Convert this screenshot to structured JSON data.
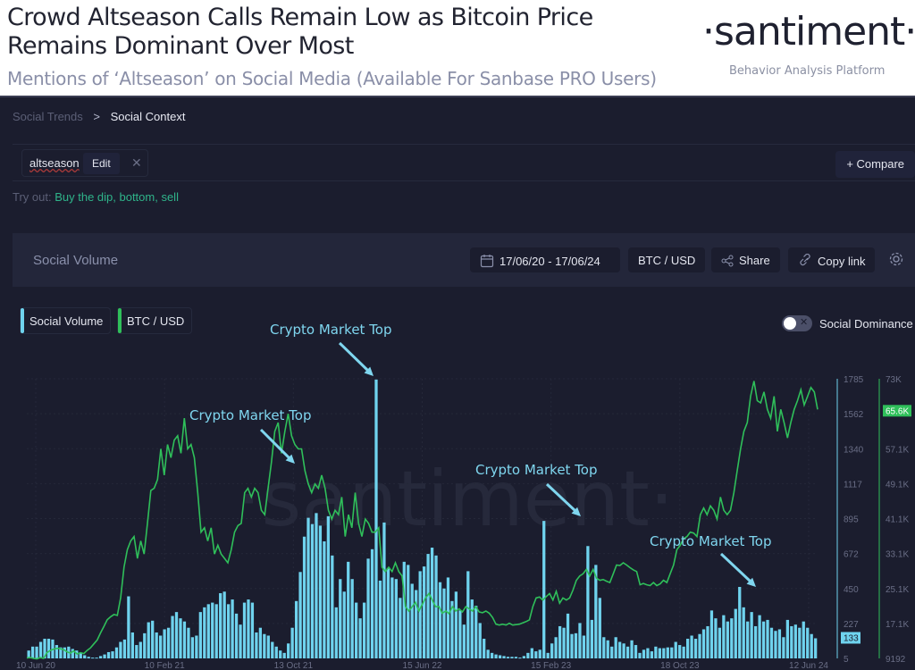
{
  "header": {
    "title": "Crowd Altseason Calls Remain Low as Bitcoin Price Remains Dominant Over Most",
    "subtitle": "Mentions of ‘Altseason’ on Social Media (Available For Sanbase PRO Users)",
    "logo": "·santiment·",
    "logo_tagline": "Behavior Analysis Platform"
  },
  "breadcrumb": {
    "parent": "Social Trends",
    "separator": ">",
    "current": "Social Context"
  },
  "search": {
    "term": "altseason",
    "edit_label": "Edit",
    "remove_icon": "close-icon",
    "compare_label": "+ Compare"
  },
  "tryout": {
    "label": "Try out:",
    "suggestions": "Buy the dip, bottom, sell"
  },
  "panel": {
    "title": "Social Volume",
    "date_range": "17/06/20 - 17/06/24",
    "pair": "BTC / USD",
    "share_label": "Share",
    "copy_link_label": "Copy link",
    "settings_icon": "gear-icon"
  },
  "legend": {
    "items": [
      {
        "label": "Social Volume",
        "color": "#6fd3ee"
      },
      {
        "label": "BTC / USD",
        "color": "#2fbf5a"
      }
    ],
    "toggle_label": "Social Dominance",
    "toggle_on": false
  },
  "colors": {
    "bars": "#6fd3ee",
    "line": "#2fbf5a",
    "annotation": "#7fd6ef",
    "background": "#1b1d2e"
  },
  "chart_data": {
    "type": "bar",
    "title": "Social Volume",
    "xlabel": "",
    "ylabel": "",
    "x_ticks": [
      "10 Jun 20",
      "10 Feb 21",
      "13 Oct 21",
      "15 Jun 22",
      "15 Feb 23",
      "18 Oct 23",
      "12 Jun 24"
    ],
    "y_left_ticks": [
      "5",
      "227",
      "450",
      "672",
      "895",
      "1117",
      "1340",
      "1562",
      "1785"
    ],
    "y_right_ticks": [
      "9192",
      "17.1K",
      "25.1K",
      "33.1K",
      "41.1K",
      "49.1K",
      "57.1K",
      "65.6K",
      "73K"
    ],
    "ylim_left": [
      5,
      1785
    ],
    "ylim_right": [
      9192,
      73000
    ],
    "current_values": {
      "social_volume": "133",
      "btc_usd": "65.6K"
    },
    "watermark": "·santiment·",
    "grid": true,
    "series": [
      {
        "name": "Social Volume",
        "type": "bar",
        "values": [
          55,
          80,
          80,
          110,
          130,
          130,
          125,
          90,
          75,
          75,
          80,
          65,
          55,
          40,
          25,
          15,
          10,
          10,
          20,
          30,
          45,
          50,
          75,
          110,
          125,
          400,
          170,
          90,
          110,
          165,
          235,
          245,
          170,
          150,
          190,
          200,
          275,
          300,
          260,
          240,
          200,
          140,
          150,
          300,
          330,
          350,
          360,
          350,
          420,
          430,
          350,
          380,
          290,
          220,
          360,
          380,
          360,
          170,
          200,
          160,
          150,
          110,
          80,
          55,
          40,
          100,
          200,
          370,
          555,
          780,
          900,
          860,
          930,
          850,
          750,
          910,
          660,
          330,
          510,
          430,
          620,
          510,
          360,
          260,
          360,
          640,
          700,
          1780,
          500,
          870,
          580,
          520,
          510,
          390,
          620,
          600,
          480,
          440,
          560,
          590,
          670,
          710,
          660,
          490,
          450,
          520,
          370,
          430,
          310,
          220,
          560,
          380,
          340,
          230,
          130,
          60,
          40,
          30,
          25,
          20,
          15,
          15,
          15,
          10,
          20,
          40,
          70,
          50,
          60,
          880,
          40,
          100,
          140,
          210,
          200,
          290,
          160,
          165,
          230,
          150,
          720,
          250,
          600,
          390,
          140,
          120,
          80,
          140,
          110,
          100,
          80,
          120,
          90,
          40,
          60,
          70,
          50,
          80,
          70,
          70,
          75,
          75,
          110,
          90,
          80,
          130,
          150,
          130,
          160,
          190,
          210,
          310,
          260,
          200,
          280,
          240,
          260,
          320,
          460,
          330,
          240,
          300,
          210,
          280,
          240,
          250,
          200,
          180,
          190,
          140,
          250,
          210,
          220,
          200,
          240,
          200,
          160,
          133
        ]
      },
      {
        "name": "BTC / USD",
        "type": "line",
        "values": [
          9300,
          9400,
          9200,
          9100,
          9400,
          9200,
          10500,
          11000,
          11300,
          11500,
          11400,
          11200,
          10700,
          10400,
          10900,
          10200,
          10500,
          10300,
          11000,
          11600,
          12500,
          13400,
          15000,
          16500,
          18000,
          18700,
          19200,
          19000,
          23000,
          30000,
          34000,
          36000,
          37000,
          32000,
          36000,
          33000,
          40000,
          47500,
          48000,
          50000,
          57000,
          51000,
          58000,
          55000,
          59000,
          60000,
          56000,
          64000,
          57000,
          58000,
          55000,
          47000,
          38000,
          39000,
          36000,
          39000,
          33000,
          35000,
          33000,
          32000,
          31000,
          34000,
          38000,
          39500,
          40000,
          47000,
          48000,
          46000,
          48000,
          47000,
          43000,
          42000,
          48000,
          54000,
          61000,
          63000,
          56000,
          61000,
          65000,
          60000,
          58000,
          57000,
          57000,
          52000,
          49000,
          47000,
          49000,
          48000,
          51000,
          48000,
          43000,
          41000,
          43000,
          42000,
          46000,
          37000,
          42000,
          39000,
          47000,
          40000,
          37000,
          41000,
          40000,
          38000,
          38000,
          39000,
          30000,
          29000,
          30000,
          29000,
          31000,
          29000,
          28000,
          21000,
          20000,
          21000,
          22000,
          20000,
          21500,
          23000,
          24000,
          22500,
          21000,
          21000,
          19500,
          20000,
          19400,
          21000,
          20000,
          20500,
          19800,
          21000,
          20500,
          20000,
          21000,
          19800,
          19600,
          20000,
          19500,
          18500,
          17000,
          16800,
          17000,
          16800,
          17200,
          16800,
          16900,
          17000,
          17300,
          17600,
          18000,
          21000,
          23000,
          23200,
          22500,
          23300,
          24000,
          22500,
          24500,
          21800,
          23000,
          22500,
          23000,
          24800,
          27000,
          28000,
          28500,
          29500,
          28000,
          29500,
          27500,
          27000,
          27200,
          26800,
          26500,
          28500,
          30500,
          30400,
          31000,
          30500,
          29900,
          29400,
          29000,
          26000,
          26300,
          26000,
          25800,
          26500,
          25800,
          26200,
          27000,
          26500,
          28500,
          30500,
          34000,
          35000,
          36500,
          37000,
          38000,
          37800,
          37000,
          42000,
          43500,
          42000,
          44000,
          43000,
          41000,
          46000,
          43000,
          42000,
          43000,
          47000,
          52000,
          57000,
          61000,
          63000,
          69000,
          72500,
          68000,
          67500,
          70000,
          66000,
          64000,
          69000,
          61000,
          66000,
          63000,
          59500,
          63000,
          66000,
          68000,
          70500,
          67000,
          69000,
          71000,
          70000,
          66000
        ]
      }
    ],
    "annotations": [
      {
        "text": "Crypto Market Top",
        "target": "May 2021 social volume spike"
      },
      {
        "text": "Crypto Market Top",
        "target": "Nov 2021 social volume spike (1785)"
      },
      {
        "text": "Crypto Market Top",
        "target": "Apr 2023 social volume spike"
      },
      {
        "text": "Crypto Market Top",
        "target": "Mar 2024 social volume spike"
      }
    ]
  }
}
